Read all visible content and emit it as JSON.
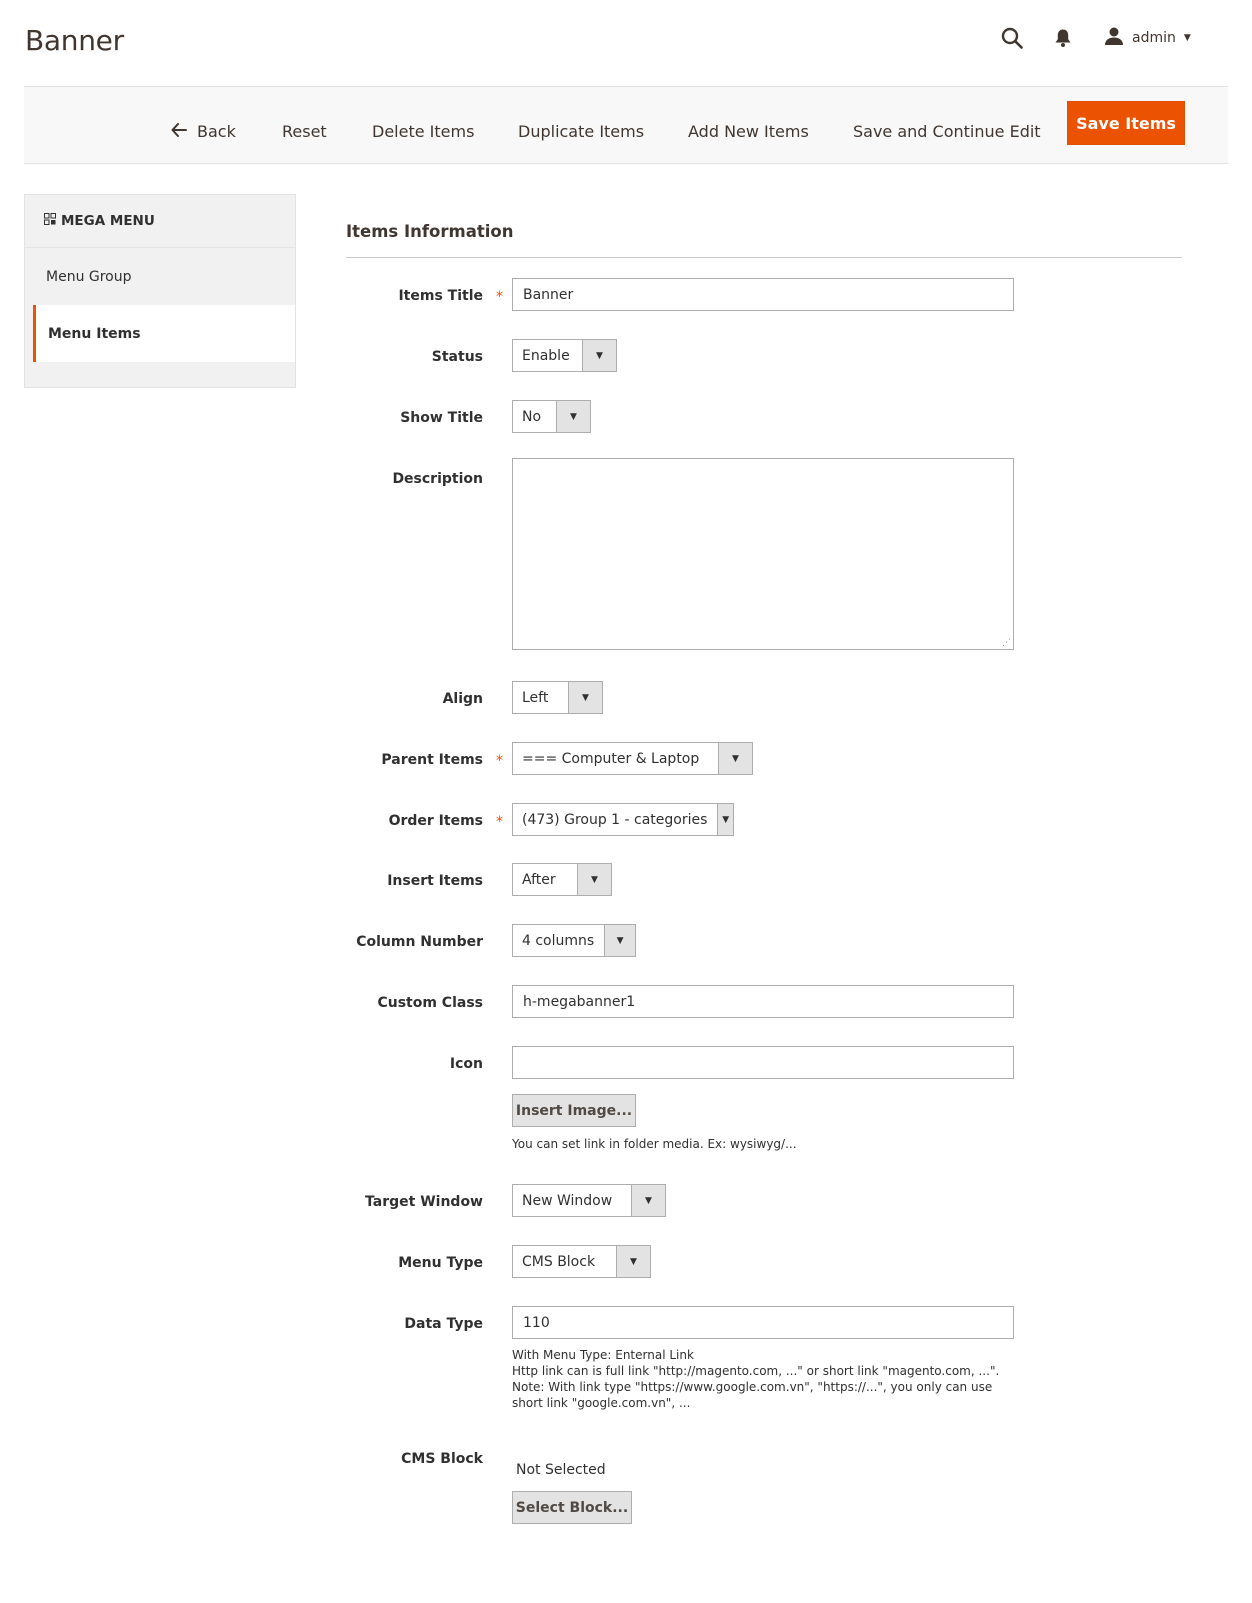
{
  "header": {
    "title": "Banner",
    "user": "admin",
    "icons": {
      "search": "search-icon",
      "notifications": "bell-icon",
      "user": "user-icon"
    }
  },
  "actions": {
    "back": "Back",
    "reset": "Reset",
    "delete": "Delete Items",
    "duplicate": "Duplicate Items",
    "add_new": "Add New Items",
    "save_continue": "Save and Continue Edit",
    "save": "Save Items"
  },
  "sidebar": {
    "title": "MEGA MENU",
    "items": [
      {
        "label": "Menu Group"
      },
      {
        "label": "Menu Items"
      }
    ]
  },
  "form": {
    "section_title": "Items Information",
    "items_title": {
      "label": "Items Title",
      "value": "Banner"
    },
    "status": {
      "label": "Status",
      "value": "Enable"
    },
    "show_title": {
      "label": "Show Title",
      "value": "No"
    },
    "description": {
      "label": "Description",
      "value": ""
    },
    "align": {
      "label": "Align",
      "value": "Left"
    },
    "parent_items": {
      "label": "Parent Items",
      "value": "=== Computer & Laptop"
    },
    "order_items": {
      "label": "Order Items",
      "value": "(473) Group 1 - categories"
    },
    "insert_items": {
      "label": "Insert Items",
      "value": "After"
    },
    "column_number": {
      "label": "Column Number",
      "value": "4 columns"
    },
    "custom_class": {
      "label": "Custom Class",
      "value": "h-megabanner1"
    },
    "icon": {
      "label": "Icon",
      "value": "",
      "button": "Insert Image...",
      "note": "You can set link in folder media. Ex: wysiwyg/..."
    },
    "target_window": {
      "label": "Target Window",
      "value": "New Window"
    },
    "menu_type": {
      "label": "Menu Type",
      "value": "CMS Block"
    },
    "data_type": {
      "label": "Data Type",
      "value": "110",
      "note_1": "With Menu Type: Enternal Link",
      "note_2": "Http link can is full link \"http://magento.com, ...\" or short link \"magento.com, ...\".",
      "note_3": "Note: With link type \"https://www.google.com.vn\", \"https://...\", you only can use short link \"google.com.vn\", ..."
    },
    "cms_block": {
      "label": "CMS Block",
      "value": "Not Selected",
      "button": "Select Block..."
    }
  },
  "colors": {
    "accent": "#eb5202",
    "text": "#303030",
    "border": "#adadad",
    "bar_bg": "#f8f8f8"
  }
}
